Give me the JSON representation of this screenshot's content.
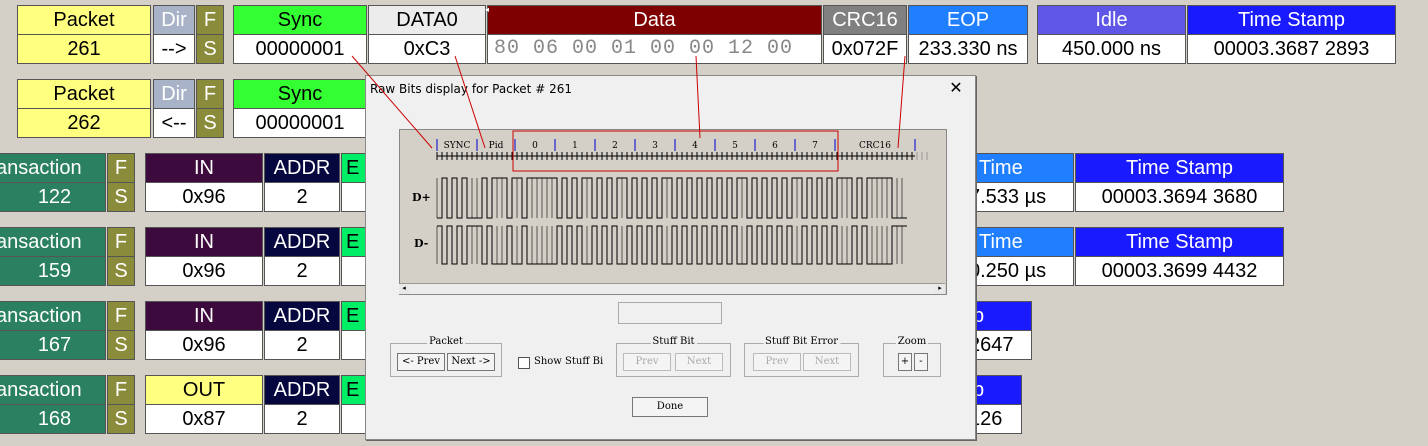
{
  "rows": {
    "packet261": {
      "packet_label": "Packet",
      "packet": "261",
      "dir_label": "Dir",
      "dir": "-->",
      "f_label": "F",
      "f": "S",
      "sync_label": "Sync",
      "sync": "00000001",
      "pid_label": "DATA0",
      "pid": "0xC3",
      "data_label": "Data",
      "data": "80 06 00 01 00 00 12 00",
      "crc_label": "CRC16",
      "crc": "0x072F",
      "eop_label": "EOP",
      "eop": "233.330 ns",
      "idle_label": "Idle",
      "idle": "450.000 ns",
      "ts_label": "Time Stamp",
      "ts": "00003.3687 2893"
    },
    "packet262": {
      "packet_label": "Packet",
      "packet": "262",
      "dir_label": "Dir",
      "dir": "<--",
      "f_label": "F",
      "f": "S",
      "sync_label": "Sync",
      "sync": "00000001"
    },
    "trans122": {
      "trans_label": "ansaction",
      "trans": "122",
      "f_label": "F",
      "f": "S",
      "tok_label": "IN",
      "tok": "0x96",
      "addr_label": "ADDR",
      "addr": "2",
      "endp_label": "E",
      "time_label": "Time",
      "time": "7.533 µs",
      "ts_label": "Time Stamp",
      "ts": "00003.3694 3680"
    },
    "trans159": {
      "trans_label": "ansaction",
      "trans": "159",
      "f_label": "F",
      "f": "S",
      "tok_label": "IN",
      "tok": "0x96",
      "addr_label": "ADDR",
      "addr": "2",
      "endp_label": "E",
      "time_label": "Time",
      "time": "0.250 µs",
      "ts_label": "Time Stamp",
      "ts": "00003.3699 4432"
    },
    "trans167": {
      "trans_label": "ansaction",
      "trans": "167",
      "f_label": "F",
      "f": "S",
      "tok_label": "IN",
      "tok": "0x96",
      "addr_label": "ADDR",
      "addr": "2",
      "endp_label": "E",
      "tail_label": "p",
      "tail": "2647"
    },
    "trans168": {
      "trans_label": "ansaction",
      "trans": "168",
      "f_label": "F",
      "f": "S",
      "tok_label": "OUT",
      "tok": "0x87",
      "addr_label": "ADDR",
      "addr": "2",
      "endp_label": "E",
      "tail_label": "p",
      "tail": "126"
    }
  },
  "dialog": {
    "title": "Raw Bits display for Packet # 261",
    "close": "✕",
    "fields": [
      "SYNC",
      "Pid",
      "0",
      "1",
      "2",
      "3",
      "4",
      "5",
      "6",
      "7",
      "CRC16"
    ],
    "signals": [
      "D+",
      "D-"
    ],
    "packet_group": "Packet",
    "prev": "<- Prev",
    "next": "Next ->",
    "show_stuff": "Show Stuff Bi",
    "stuff_group": "Stuff Bit",
    "stuff_prev": "Prev",
    "stuff_next": "Next",
    "stuff_err_group": "Stuff Bit Error",
    "err_prev": "Prev",
    "err_next": "Next",
    "zoom_group": "Zoom",
    "zoom_in": "+",
    "zoom_out": "-",
    "done": "Done"
  },
  "colors": {
    "marker_red": "#cc0000",
    "field_tick_blue": "#0000cc"
  }
}
